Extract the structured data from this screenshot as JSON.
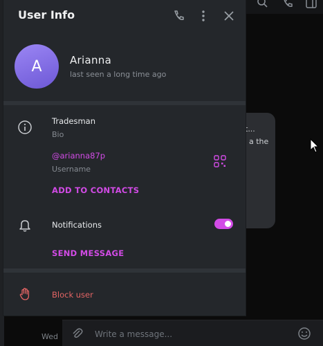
{
  "panel": {
    "title": "User Info",
    "icons": {
      "call": "phone-icon",
      "more": "more-vertical-icon",
      "close": "close-icon"
    }
  },
  "profile": {
    "initial": "A",
    "name": "Arianna",
    "status": "last seen a long time ago"
  },
  "info": {
    "bio_value": "Tradesman",
    "bio_label": "Bio",
    "username_value": "@arianna87p",
    "username_label": "Username",
    "add_contact": "ADD TO CONTACTS"
  },
  "notifications": {
    "label": "Notifications",
    "enabled": true,
    "send_message": "SEND MESSAGE"
  },
  "danger": {
    "block": "Block user"
  },
  "background": {
    "bubble_line1": "t...",
    "bubble_line2": "a the",
    "composer_placeholder": "Write a message...",
    "day_label": "Wed"
  },
  "colors": {
    "accent": "#d24be6",
    "danger": "#e26464",
    "panel_bg": "#24272b",
    "avatar_from": "#9b86f4",
    "avatar_to": "#6d58d6"
  }
}
